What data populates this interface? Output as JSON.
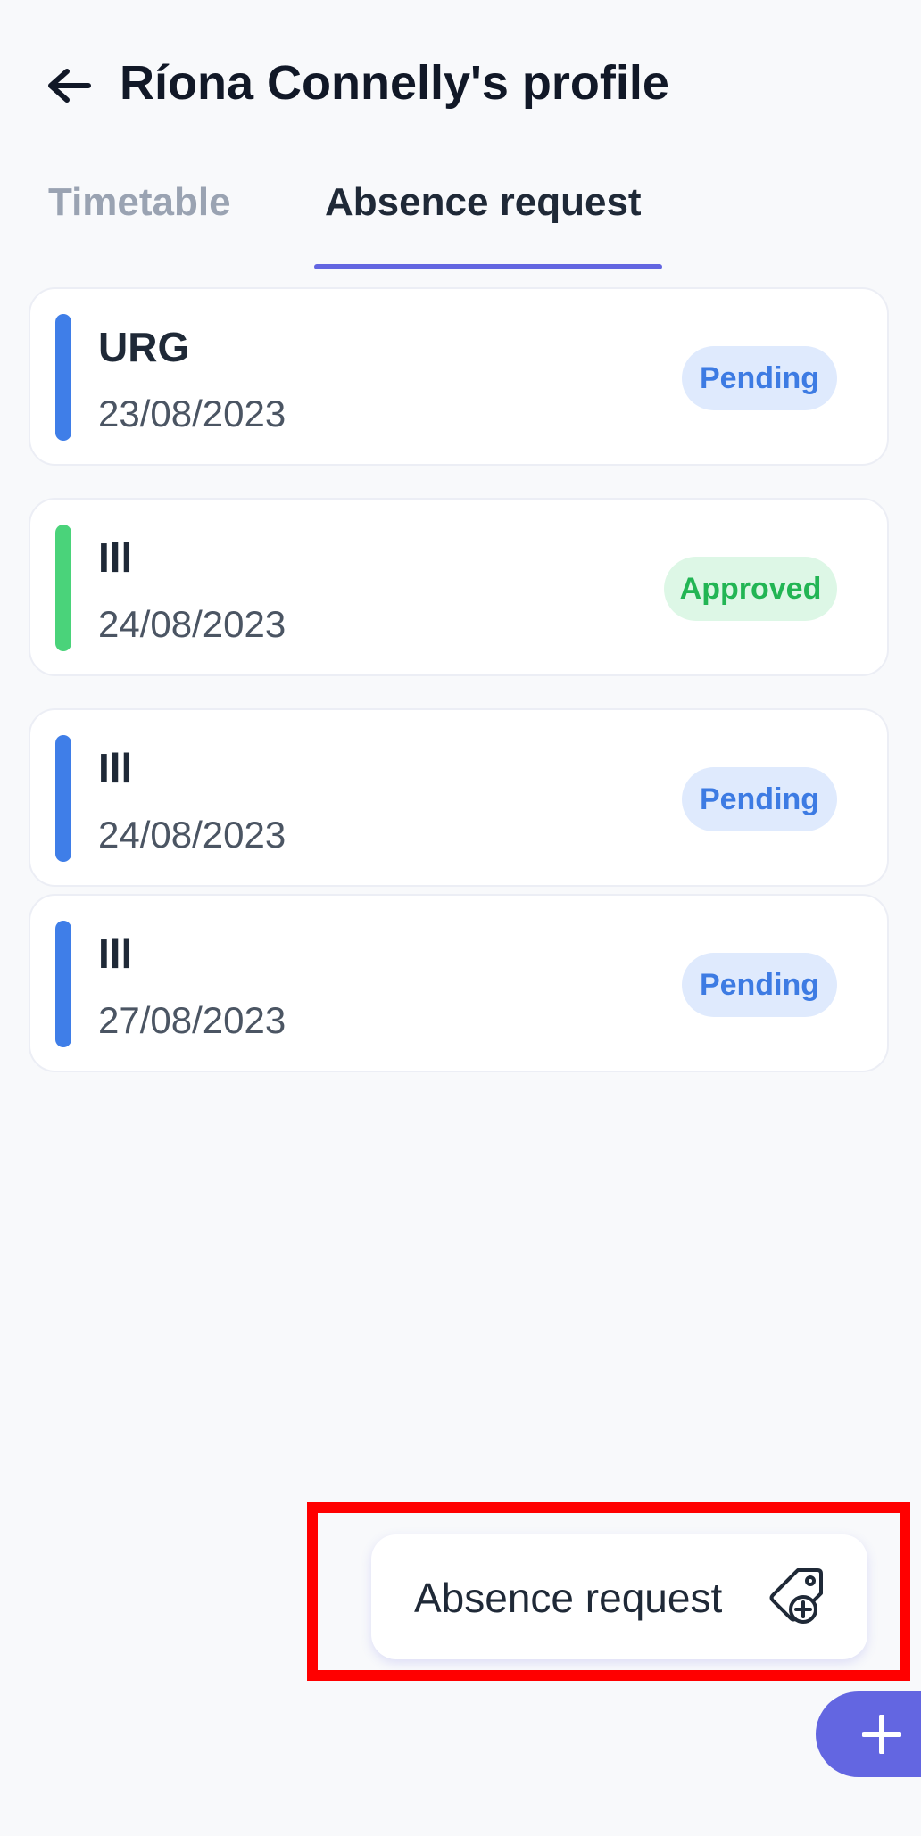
{
  "header": {
    "title": "Ríona Connelly's profile"
  },
  "tabs": [
    {
      "label": "Timetable"
    },
    {
      "label": "Absence request"
    }
  ],
  "requests": [
    {
      "reason": "URG",
      "date": "23/08/2023",
      "status": "Pending"
    },
    {
      "reason": "Ill",
      "date": "24/08/2023",
      "status": "Approved"
    },
    {
      "reason": "Ill",
      "date": "24/08/2023",
      "status": "Pending"
    },
    {
      "reason": "Ill",
      "date": "27/08/2023",
      "status": "Pending"
    }
  ],
  "popup": {
    "label": "Absence request",
    "icon": "tag-plus-icon"
  },
  "fab": {
    "icon": "plus-icon"
  },
  "colors": {
    "accent": "#6366e1",
    "pending": "#3d7be3",
    "approved": "#22b554",
    "pending_bar": "#3f7ee8",
    "approved_bar": "#4ad37a"
  }
}
